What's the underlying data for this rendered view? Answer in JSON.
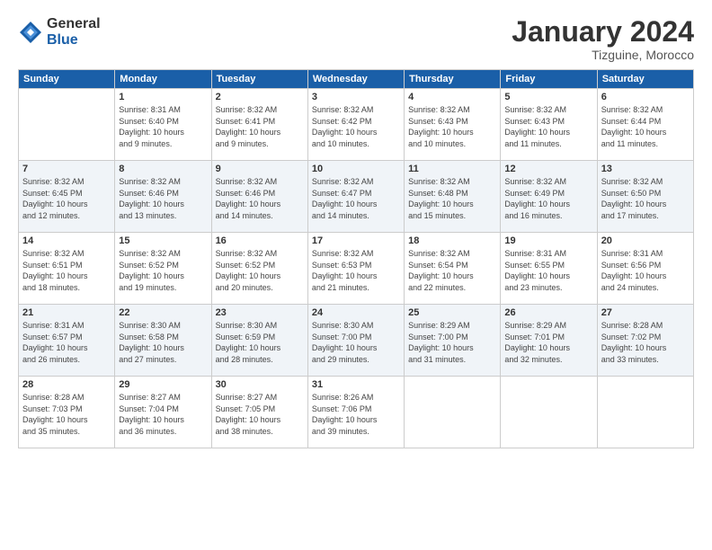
{
  "logo": {
    "general": "General",
    "blue": "Blue"
  },
  "title": "January 2024",
  "location": "Tizguine, Morocco",
  "days_of_week": [
    "Sunday",
    "Monday",
    "Tuesday",
    "Wednesday",
    "Thursday",
    "Friday",
    "Saturday"
  ],
  "weeks": [
    [
      {
        "day": "",
        "info": ""
      },
      {
        "day": "1",
        "info": "Sunrise: 8:31 AM\nSunset: 6:40 PM\nDaylight: 10 hours\nand 9 minutes."
      },
      {
        "day": "2",
        "info": "Sunrise: 8:32 AM\nSunset: 6:41 PM\nDaylight: 10 hours\nand 9 minutes."
      },
      {
        "day": "3",
        "info": "Sunrise: 8:32 AM\nSunset: 6:42 PM\nDaylight: 10 hours\nand 10 minutes."
      },
      {
        "day": "4",
        "info": "Sunrise: 8:32 AM\nSunset: 6:43 PM\nDaylight: 10 hours\nand 10 minutes."
      },
      {
        "day": "5",
        "info": "Sunrise: 8:32 AM\nSunset: 6:43 PM\nDaylight: 10 hours\nand 11 minutes."
      },
      {
        "day": "6",
        "info": "Sunrise: 8:32 AM\nSunset: 6:44 PM\nDaylight: 10 hours\nand 11 minutes."
      }
    ],
    [
      {
        "day": "7",
        "info": "Sunrise: 8:32 AM\nSunset: 6:45 PM\nDaylight: 10 hours\nand 12 minutes."
      },
      {
        "day": "8",
        "info": "Sunrise: 8:32 AM\nSunset: 6:46 PM\nDaylight: 10 hours\nand 13 minutes."
      },
      {
        "day": "9",
        "info": "Sunrise: 8:32 AM\nSunset: 6:46 PM\nDaylight: 10 hours\nand 14 minutes."
      },
      {
        "day": "10",
        "info": "Sunrise: 8:32 AM\nSunset: 6:47 PM\nDaylight: 10 hours\nand 14 minutes."
      },
      {
        "day": "11",
        "info": "Sunrise: 8:32 AM\nSunset: 6:48 PM\nDaylight: 10 hours\nand 15 minutes."
      },
      {
        "day": "12",
        "info": "Sunrise: 8:32 AM\nSunset: 6:49 PM\nDaylight: 10 hours\nand 16 minutes."
      },
      {
        "day": "13",
        "info": "Sunrise: 8:32 AM\nSunset: 6:50 PM\nDaylight: 10 hours\nand 17 minutes."
      }
    ],
    [
      {
        "day": "14",
        "info": "Sunrise: 8:32 AM\nSunset: 6:51 PM\nDaylight: 10 hours\nand 18 minutes."
      },
      {
        "day": "15",
        "info": "Sunrise: 8:32 AM\nSunset: 6:52 PM\nDaylight: 10 hours\nand 19 minutes."
      },
      {
        "day": "16",
        "info": "Sunrise: 8:32 AM\nSunset: 6:52 PM\nDaylight: 10 hours\nand 20 minutes."
      },
      {
        "day": "17",
        "info": "Sunrise: 8:32 AM\nSunset: 6:53 PM\nDaylight: 10 hours\nand 21 minutes."
      },
      {
        "day": "18",
        "info": "Sunrise: 8:32 AM\nSunset: 6:54 PM\nDaylight: 10 hours\nand 22 minutes."
      },
      {
        "day": "19",
        "info": "Sunrise: 8:31 AM\nSunset: 6:55 PM\nDaylight: 10 hours\nand 23 minutes."
      },
      {
        "day": "20",
        "info": "Sunrise: 8:31 AM\nSunset: 6:56 PM\nDaylight: 10 hours\nand 24 minutes."
      }
    ],
    [
      {
        "day": "21",
        "info": "Sunrise: 8:31 AM\nSunset: 6:57 PM\nDaylight: 10 hours\nand 26 minutes."
      },
      {
        "day": "22",
        "info": "Sunrise: 8:30 AM\nSunset: 6:58 PM\nDaylight: 10 hours\nand 27 minutes."
      },
      {
        "day": "23",
        "info": "Sunrise: 8:30 AM\nSunset: 6:59 PM\nDaylight: 10 hours\nand 28 minutes."
      },
      {
        "day": "24",
        "info": "Sunrise: 8:30 AM\nSunset: 7:00 PM\nDaylight: 10 hours\nand 29 minutes."
      },
      {
        "day": "25",
        "info": "Sunrise: 8:29 AM\nSunset: 7:00 PM\nDaylight: 10 hours\nand 31 minutes."
      },
      {
        "day": "26",
        "info": "Sunrise: 8:29 AM\nSunset: 7:01 PM\nDaylight: 10 hours\nand 32 minutes."
      },
      {
        "day": "27",
        "info": "Sunrise: 8:28 AM\nSunset: 7:02 PM\nDaylight: 10 hours\nand 33 minutes."
      }
    ],
    [
      {
        "day": "28",
        "info": "Sunrise: 8:28 AM\nSunset: 7:03 PM\nDaylight: 10 hours\nand 35 minutes."
      },
      {
        "day": "29",
        "info": "Sunrise: 8:27 AM\nSunset: 7:04 PM\nDaylight: 10 hours\nand 36 minutes."
      },
      {
        "day": "30",
        "info": "Sunrise: 8:27 AM\nSunset: 7:05 PM\nDaylight: 10 hours\nand 38 minutes."
      },
      {
        "day": "31",
        "info": "Sunrise: 8:26 AM\nSunset: 7:06 PM\nDaylight: 10 hours\nand 39 minutes."
      },
      {
        "day": "",
        "info": ""
      },
      {
        "day": "",
        "info": ""
      },
      {
        "day": "",
        "info": ""
      }
    ]
  ]
}
